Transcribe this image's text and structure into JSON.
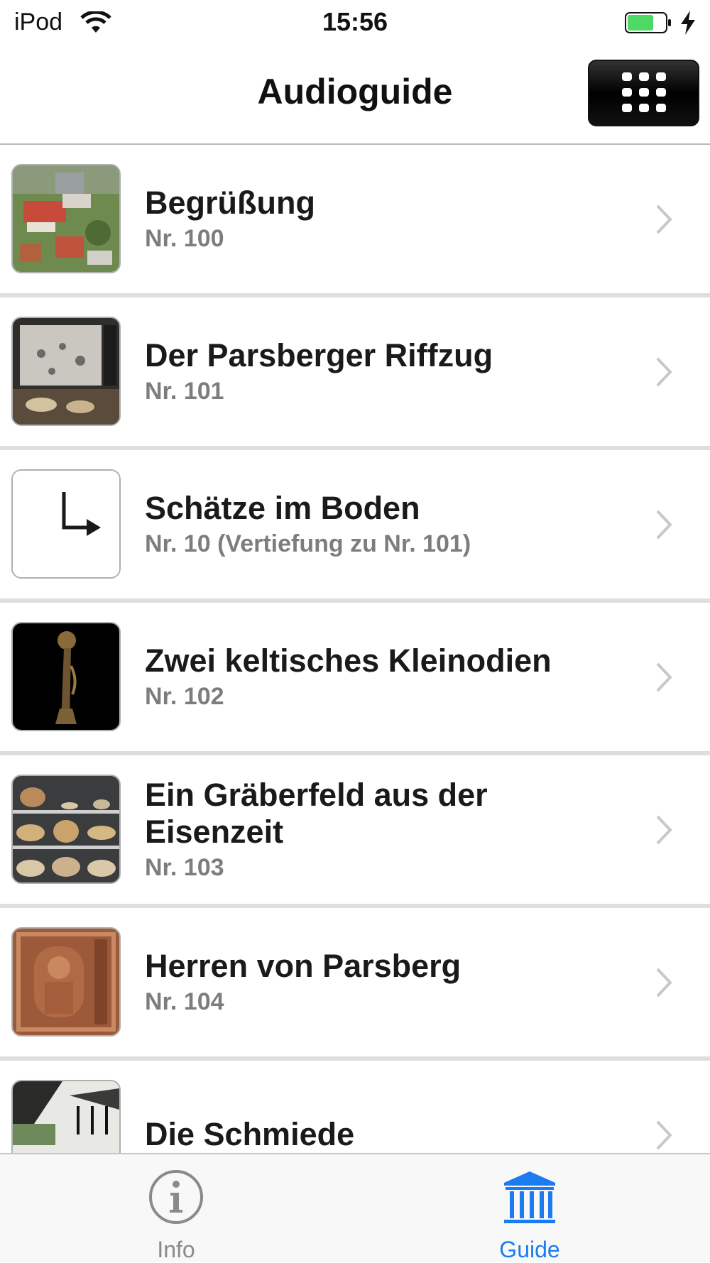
{
  "status_bar": {
    "device": "iPod",
    "time": "15:56",
    "battery_color": "#4cd964",
    "wifi_icon": "wifi-icon",
    "charging_icon": "bolt-icon"
  },
  "nav": {
    "title": "Audioguide",
    "keypad_icon": "keypad-grid-icon"
  },
  "items": [
    {
      "title": "Begrüßung",
      "subtitle": "Nr. 100",
      "thumb": "castle-aerial-photo"
    },
    {
      "title": "Der Parsberger Riffzug",
      "subtitle": "Nr. 101",
      "thumb": "exhibit-display-photo"
    },
    {
      "title": "Schätze im Boden",
      "subtitle": "Nr. 10 (Vertiefung zu Nr. 101)",
      "thumb": "branch-arrow-icon"
    },
    {
      "title": "Zwei keltisches Kleinodien",
      "subtitle": "Nr. 102",
      "thumb": "celtic-object-photo"
    },
    {
      "title": "Ein Gräberfeld aus der Eisenzeit",
      "subtitle": "Nr. 103",
      "thumb": "pottery-shelf-photo"
    },
    {
      "title": "Herren von Parsberg",
      "subtitle": "Nr. 104",
      "thumb": "stone-relief-photo"
    },
    {
      "title": "Die Schmiede",
      "subtitle": "",
      "thumb": "smithy-photo"
    }
  ],
  "tabs": {
    "info": {
      "label": "Info",
      "icon": "info-icon",
      "color": "#8a8a8a"
    },
    "guide": {
      "label": "Guide",
      "icon": "museum-icon",
      "color": "#1a7cf0",
      "selected": true
    }
  }
}
